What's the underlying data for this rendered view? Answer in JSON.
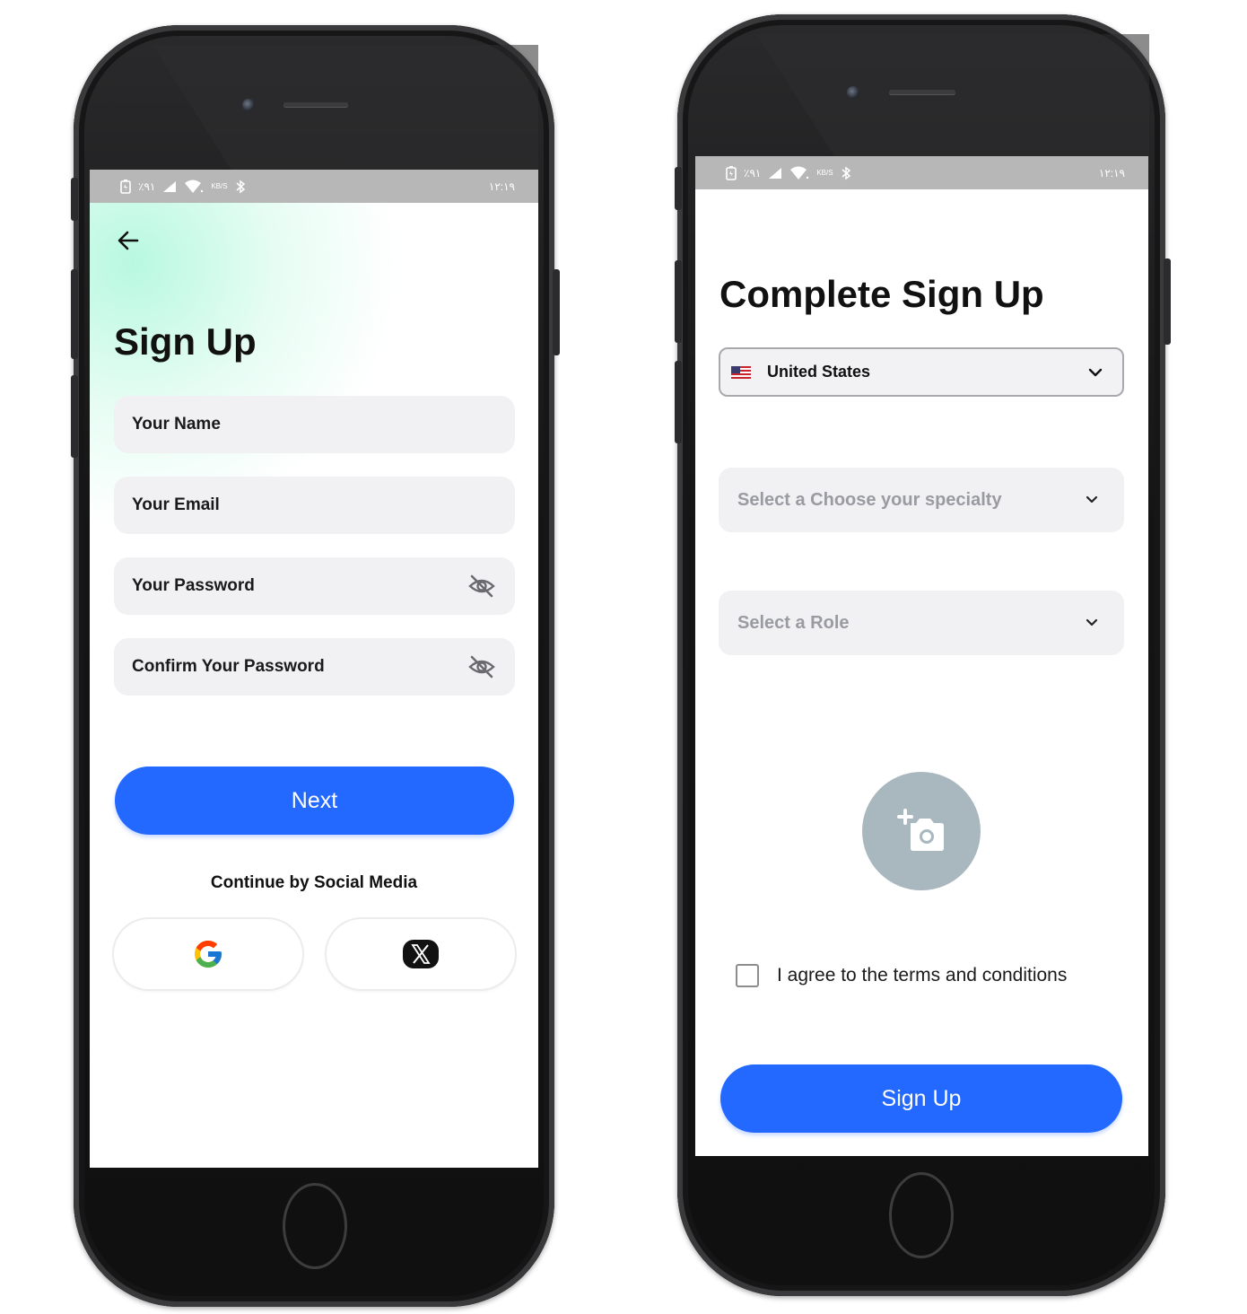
{
  "status_bar": {
    "left": {
      "battery_text": "٪۹۱",
      "speed_text": "KB/S"
    },
    "time": "۱۲:۱۹"
  },
  "signup_screen": {
    "title": "Sign Up",
    "fields": [
      {
        "label": "Your Name",
        "icon": null
      },
      {
        "label": "Your Email",
        "icon": null
      },
      {
        "label": "Your Password",
        "icon": "eye-off-icon"
      },
      {
        "label": "Confirm Your Password",
        "icon": "eye-off-icon"
      }
    ],
    "next_label": "Next",
    "social_title": "Continue by Social Media",
    "social_buttons": [
      "google-icon",
      "x-icon"
    ]
  },
  "complete_screen": {
    "title": "Complete Sign Up",
    "country": {
      "value": "United States",
      "flag": "us-flag-icon"
    },
    "specialty_placeholder": "Select a Choose your specialty",
    "role_placeholder": "Select a Role",
    "photo_icon": "add-photo-camera-icon",
    "agree_text": "I agree to the terms and conditions",
    "signup_label": "Sign Up"
  },
  "colors": {
    "primary": "#2369ff",
    "field_bg": "#f1f1f4",
    "status_bar": "#b7b7b7",
    "avatar_bg": "#a9b7be",
    "mint_glow": "#a0f6d6"
  }
}
